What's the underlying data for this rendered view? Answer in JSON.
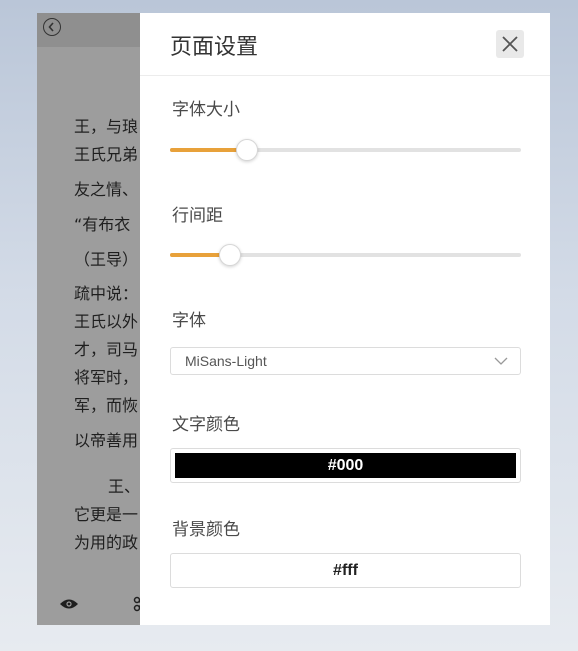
{
  "reader": {
    "lines": [
      "王，与琅",
      "王氏兄弟",
      "友之情、",
      "“有布衣",
      "（王导）",
      "疏中说：",
      "王氏以外",
      "才，司马",
      "将军时，",
      "军，而恢",
      "以帝善用",
      "王、",
      "它更是一",
      "为用的政"
    ],
    "bottom_icons": [
      "eye-icon",
      "scissors-icon"
    ]
  },
  "panel": {
    "title": "页面设置",
    "close_icon": "close-icon",
    "font_size": {
      "label": "字体大小",
      "value_fraction": 0.22
    },
    "line_spacing": {
      "label": "行间距",
      "value_fraction": 0.17
    },
    "font": {
      "label": "字体",
      "selected": "MiSans-Light"
    },
    "text_color": {
      "label": "文字颜色",
      "value": "#000"
    },
    "bg_color": {
      "label": "背景颜色",
      "value": "#fff"
    }
  },
  "colors": {
    "accent": "#e8a13a",
    "overlay": "#9d9d9d"
  }
}
